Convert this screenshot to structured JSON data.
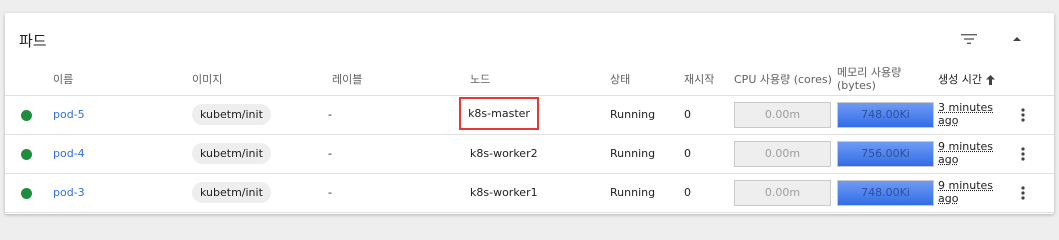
{
  "header": {
    "title": "파드"
  },
  "columns": {
    "name": "이름",
    "image": "이미지",
    "labels": "레이블",
    "node": "노드",
    "status": "상태",
    "restarts": "재시작",
    "cpu": "CPU 사용량 (cores)",
    "memory_line1": "메모리 사용량",
    "memory_line2": "(bytes)",
    "age": "생성 시간"
  },
  "rows": [
    {
      "name": "pod-5",
      "image": "kubetm/init",
      "labels": "-",
      "node": "k8s-master",
      "status": "Running",
      "restarts": "0",
      "cpu": "0.00m",
      "memory": "748.00Ki",
      "age_line1": "3 minutes",
      "age_line2": "ago"
    },
    {
      "name": "pod-4",
      "image": "kubetm/init",
      "labels": "-",
      "node": "k8s-worker2",
      "status": "Running",
      "restarts": "0",
      "cpu": "0.00m",
      "memory": "756.00Ki",
      "age_line1": "9 minutes",
      "age_line2": "ago"
    },
    {
      "name": "pod-3",
      "image": "kubetm/init",
      "labels": "-",
      "node": "k8s-worker1",
      "status": "Running",
      "restarts": "0",
      "cpu": "0.00m",
      "memory": "748.00Ki",
      "age_line1": "9 minutes",
      "age_line2": "ago"
    }
  ],
  "colors": {
    "running": "#1e8e3e",
    "link": "#326de6",
    "highlight": "#e53935",
    "memory_bar": "#326de6"
  },
  "icons": {
    "filter": "filter-icon",
    "collapse": "chevron-up-icon",
    "sort": "arrow-up-icon",
    "menu": "more-vert-icon"
  }
}
